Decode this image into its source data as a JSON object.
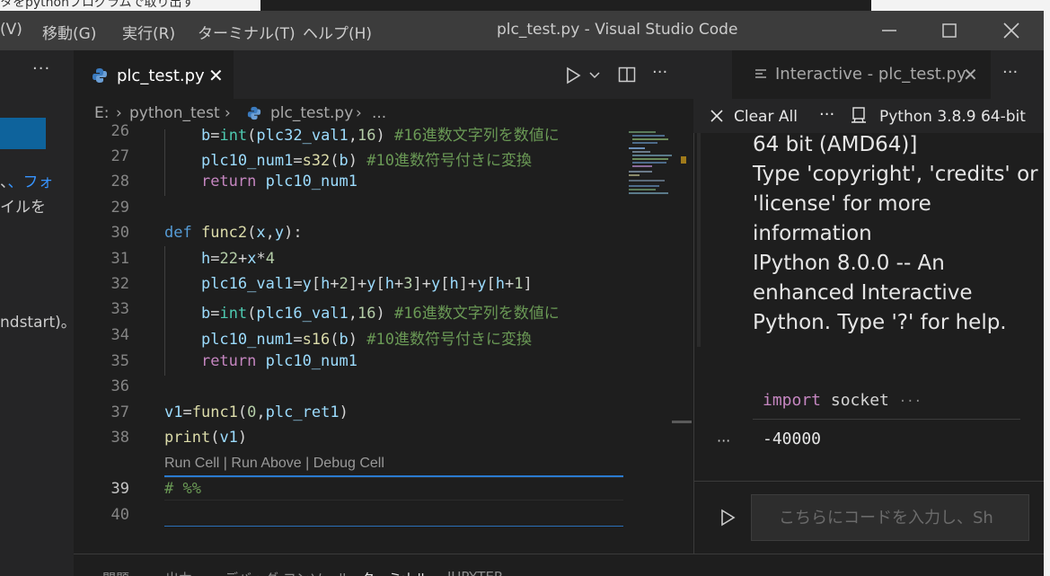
{
  "background": {
    "browser_tab_text": "タをpythonプログラムで取り出す"
  },
  "titlebar": {
    "menus": [
      "(V)",
      "移動(G)",
      "実行(R)",
      "ターミナル(T)",
      "ヘルプ(H)"
    ],
    "title": "plc_test.py - Visual Studio Code"
  },
  "sidebar": {
    "more_label": "···",
    "text_lines": [
      "、フォ",
      "イルを",
      "ndstart)。"
    ]
  },
  "editor": {
    "tab_label": "plc_test.py",
    "tab_close": "✕",
    "breadcrumb": {
      "drive": "E:",
      "folder": "python_test",
      "file": "plc_test.py",
      "ellipsis": "..."
    },
    "codelens": "Run Cell | Run Above | Debug Cell",
    "line_numbers": [
      "26",
      "27",
      "28",
      "29",
      "30",
      "31",
      "32",
      "33",
      "34",
      "35",
      "36",
      "37",
      "38",
      "39",
      "40"
    ]
  },
  "interactive": {
    "tab_label": "Interactive - plc_test.py",
    "tab_close": "✕",
    "clear_all": "Clear All",
    "kernel": "Python 3.8.9 64-bit",
    "output_lines": [
      "64 bit (AMD64)]",
      "Type 'copyright', 'credits' or",
      "'license' for more",
      "information",
      "IPython 8.0.0 -- An",
      "enhanced Interactive",
      "Python. Type '?' for help."
    ],
    "cell_keyword": "import",
    "cell_module": "socket",
    "cell_ellipsis": "···",
    "result": "-40000",
    "result_more": "···",
    "input_placeholder": "こちらにコードを入力し、Sh"
  },
  "bottom_panel": {
    "tabs": [
      "問題",
      "出力",
      "デバッグ コンソール",
      "ターミナル",
      "JUPYTER"
    ]
  }
}
